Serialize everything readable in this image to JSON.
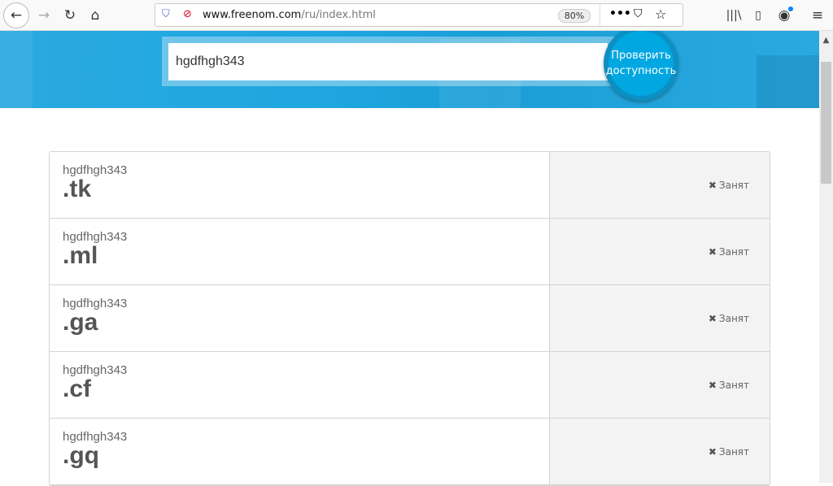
{
  "browser": {
    "url_host": "www.freenom.com",
    "url_path": "/ru/index.html",
    "zoom": "80%"
  },
  "search": {
    "value": "hgdfhgh343",
    "button_label": "Проверить доступность"
  },
  "results": [
    {
      "name": "hgdfhgh343",
      "tld": ".tk",
      "status": "Занят"
    },
    {
      "name": "hgdfhgh343",
      "tld": ".ml",
      "status": "Занят"
    },
    {
      "name": "hgdfhgh343",
      "tld": ".ga",
      "status": "Занят"
    },
    {
      "name": "hgdfhgh343",
      "tld": ".cf",
      "status": "Занят"
    },
    {
      "name": "hgdfhgh343",
      "tld": ".gq",
      "status": "Занят"
    }
  ]
}
